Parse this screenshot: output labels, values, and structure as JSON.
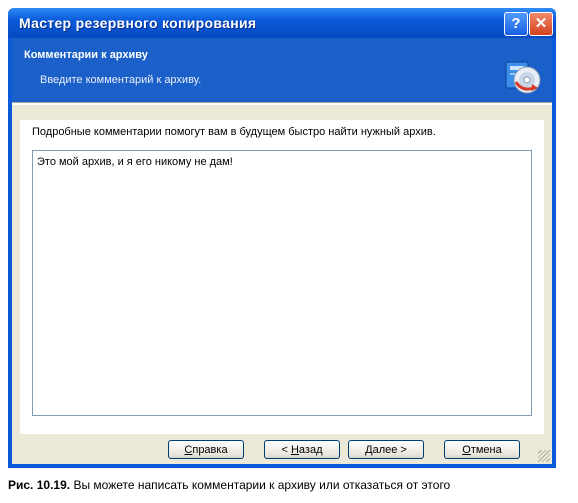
{
  "window": {
    "title": "Мастер резервного копирования",
    "help_btn": "?",
    "close_btn": "✕"
  },
  "header": {
    "title": "Комментарии к архиву",
    "subtitle": "Введите комментарий к архиву.",
    "icon": "backup-wizard-icon"
  },
  "content": {
    "description": "Подробные комментарии помогут вам в будущем быстро найти нужный архив.",
    "comment_value": "Это мой архив, и я его никому не дам!"
  },
  "buttons": {
    "help_prefix": "",
    "help_u": "С",
    "help_rest": "правка",
    "back_prefix": "< ",
    "back_u": "Н",
    "back_rest": "азад",
    "next_prefix": "",
    "next_u": "Д",
    "next_rest": "алее >",
    "cancel_prefix": "",
    "cancel_u": "О",
    "cancel_rest": "тмена"
  },
  "caption": {
    "label": "Рис. 10.19.",
    "text": "Вы можете написать комментарии к архиву или отказаться от этого"
  },
  "colors": {
    "titlebar": "#0a5ad9",
    "header": "#1b60c8",
    "dialog_bg": "#ece9d8"
  }
}
